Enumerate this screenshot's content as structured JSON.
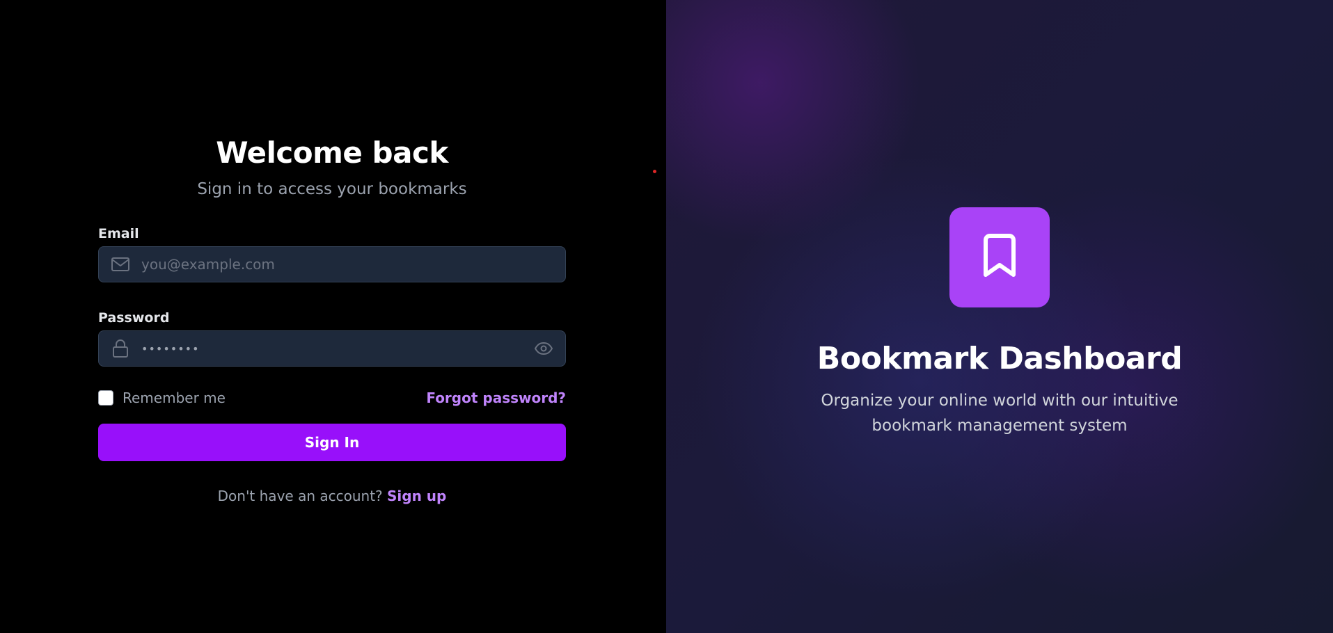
{
  "login": {
    "title": "Welcome back",
    "subtitle": "Sign in to access your bookmarks",
    "email": {
      "label": "Email",
      "placeholder": "you@example.com",
      "value": "",
      "icon": "mail-icon"
    },
    "password": {
      "label": "Password",
      "masked_value": "••••••••",
      "icon": "lock-icon",
      "toggle_icon": "eye-icon"
    },
    "remember_me": {
      "label": "Remember me",
      "checked": false
    },
    "forgot_password": "Forgot password?",
    "submit_label": "Sign In",
    "signup_prompt": "Don't have an account?",
    "signup_link": "Sign up"
  },
  "brand": {
    "icon": "bookmark-icon",
    "title": "Bookmark Dashboard",
    "description": "Organize your online world with our intuitive bookmark management system"
  },
  "colors": {
    "accent": "#9810fa",
    "link": "#c084fc",
    "logo_tile": "#a943f7",
    "input_bg": "#1e293b",
    "left_bg": "#000000",
    "right_bg": "#1c1a38"
  }
}
